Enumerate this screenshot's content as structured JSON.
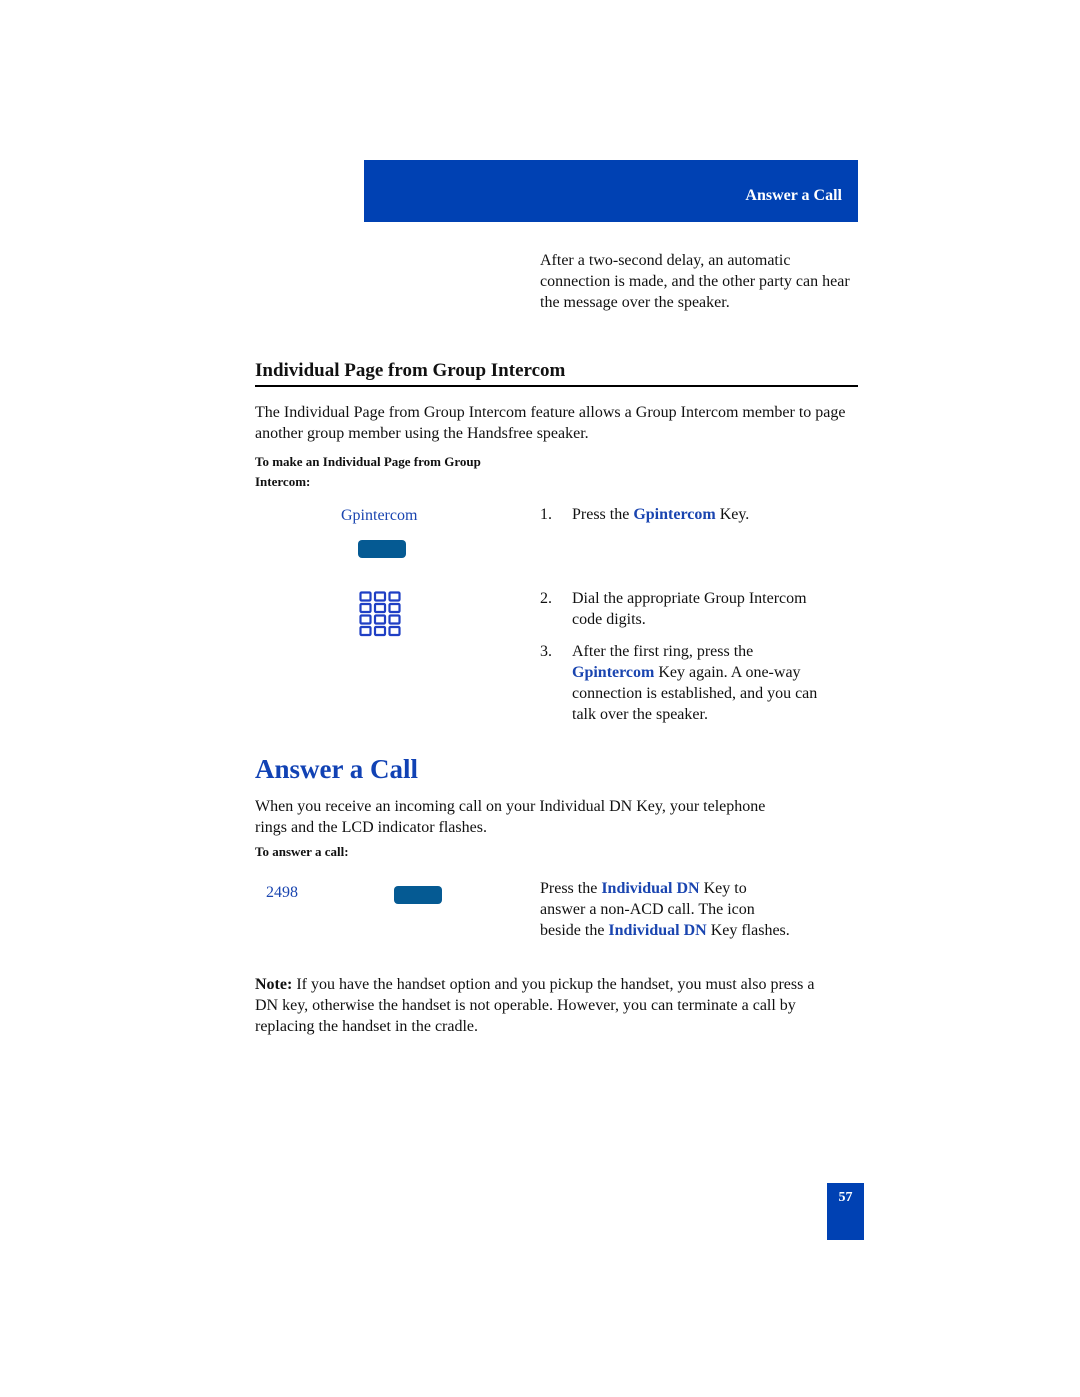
{
  "header": {
    "title": "Answer a Call"
  },
  "intro": {
    "text": "After a two-second delay, an automatic connection is made, and the other party can hear the message over the speaker."
  },
  "individual_page": {
    "heading": "Individual Page from Group Intercom",
    "description": "The Individual Page from Group Intercom feature allows a Group Intercom member to page another group member using the Handsfree speaker.",
    "procedure_label": "To make an Individual Page from Group Intercom:",
    "key_label": "Gpintercom",
    "steps": [
      {
        "num": "1.",
        "pre": "Press the ",
        "key": "Gpintercom",
        "post": " Key."
      },
      {
        "num": "2.",
        "text": "Dial the appropriate Group Intercom code digits."
      },
      {
        "num": "3.",
        "pre": "After the first ring, press the ",
        "key": "Gpintercom",
        "post": " Key again. A one-way connection is established, and you can talk over the speaker."
      }
    ]
  },
  "answer_call": {
    "heading": "Answer a Call",
    "description": "When you receive an incoming call on your Individual DN Key, your telephone rings and the LCD indicator flashes.",
    "procedure_label": "To answer a call:",
    "dn_number": "2498",
    "instruction": {
      "pre": "Press the ",
      "key1": "Individual DN",
      "mid": " Key to answer a non-ACD call. The icon beside the ",
      "key2": "Individual DN",
      "post": " Key flashes."
    },
    "note_label": "Note:",
    "note_text": " If you have the handset option and you pickup the handset, you must also press a DN key, otherwise the handset is not operable. However, you can terminate a call by replacing the handset in the cradle."
  },
  "footer": {
    "page_number": "57"
  }
}
